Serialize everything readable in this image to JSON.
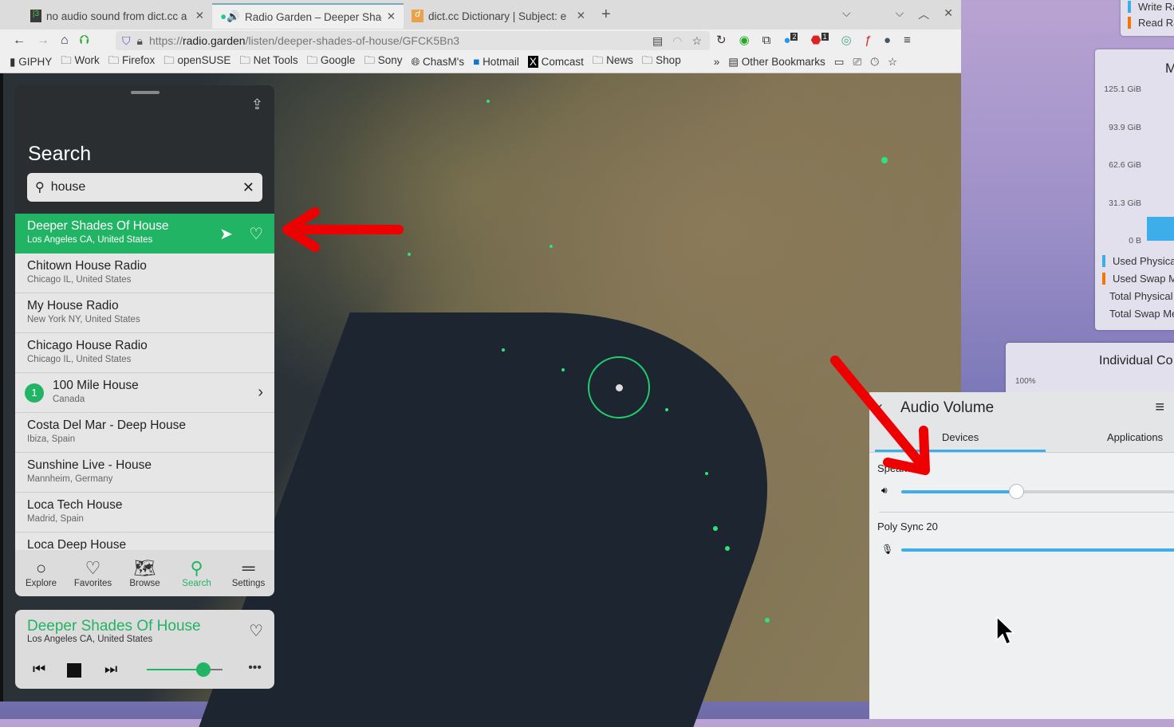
{
  "browser": {
    "tabs": [
      {
        "title": "no audio sound from dict.cc a"
      },
      {
        "title": "Radio Garden – Deeper Shac"
      },
      {
        "title": "dict.cc Dictionary | Subject: e"
      }
    ],
    "url_prefix": "https://",
    "url_domain": "radio.garden",
    "url_path": "/listen/deeper-shades-of-house/GFCK5Bn3",
    "ext_badges": [
      "2",
      "1"
    ],
    "bookmarks": [
      "GIPHY",
      "Work",
      "Firefox",
      "openSUSE",
      "Net Tools",
      "Google",
      "Sony",
      "ChasM's",
      "Hotmail",
      "Comcast",
      "News",
      "Shop"
    ],
    "other_bookmarks": "Other Bookmarks"
  },
  "radio": {
    "search_title": "Search",
    "search_value": "house",
    "results": [
      {
        "name": "Deeper Shades Of House",
        "loc": "Los Angeles CA, United States"
      },
      {
        "name": "Chitown House Radio",
        "loc": "Chicago IL, United States"
      },
      {
        "name": "My House Radio",
        "loc": "New York NY, United States"
      },
      {
        "name": "Chicago House Radio",
        "loc": "Chicago IL, United States"
      },
      {
        "name": "100 Mile House",
        "loc": "Canada",
        "badge": "1"
      },
      {
        "name": "Costa Del Mar - Deep House",
        "loc": "Ibiza, Spain"
      },
      {
        "name": "Sunshine Live - House",
        "loc": "Mannheim, Germany"
      },
      {
        "name": "Loca Tech House",
        "loc": "Madrid, Spain"
      },
      {
        "name": "Loca Deep House",
        "loc": ""
      }
    ],
    "nav": [
      "Explore",
      "Favorites",
      "Browse",
      "Search",
      "Settings"
    ],
    "player": {
      "name": "Deeper Shades Of House",
      "loc": "Los Angeles CA, United States",
      "volume": 0.75
    }
  },
  "memory": {
    "title": "M",
    "yticks": [
      "125.1 GiB",
      "93.9 GiB",
      "62.6 GiB",
      "31.3 GiB",
      "0 B"
    ],
    "legend": [
      "Used Physica",
      "Used Swap M",
      "Total Physical",
      "Total Swap Me"
    ],
    "io_legend": [
      "Write Ra",
      "Read Ra"
    ],
    "cpu_title": "Individual Co",
    "cpu_tick": "100%",
    "colors": {
      "blue": "#3daee9",
      "orange": "#f67400"
    }
  },
  "audio": {
    "title": "Audio Volume",
    "tabs": [
      "Devices",
      "Applications"
    ],
    "devices": [
      {
        "name": "Speakers",
        "volume": 0.42
      },
      {
        "name": "Poly Sync 20",
        "volume": 1.0
      }
    ]
  }
}
